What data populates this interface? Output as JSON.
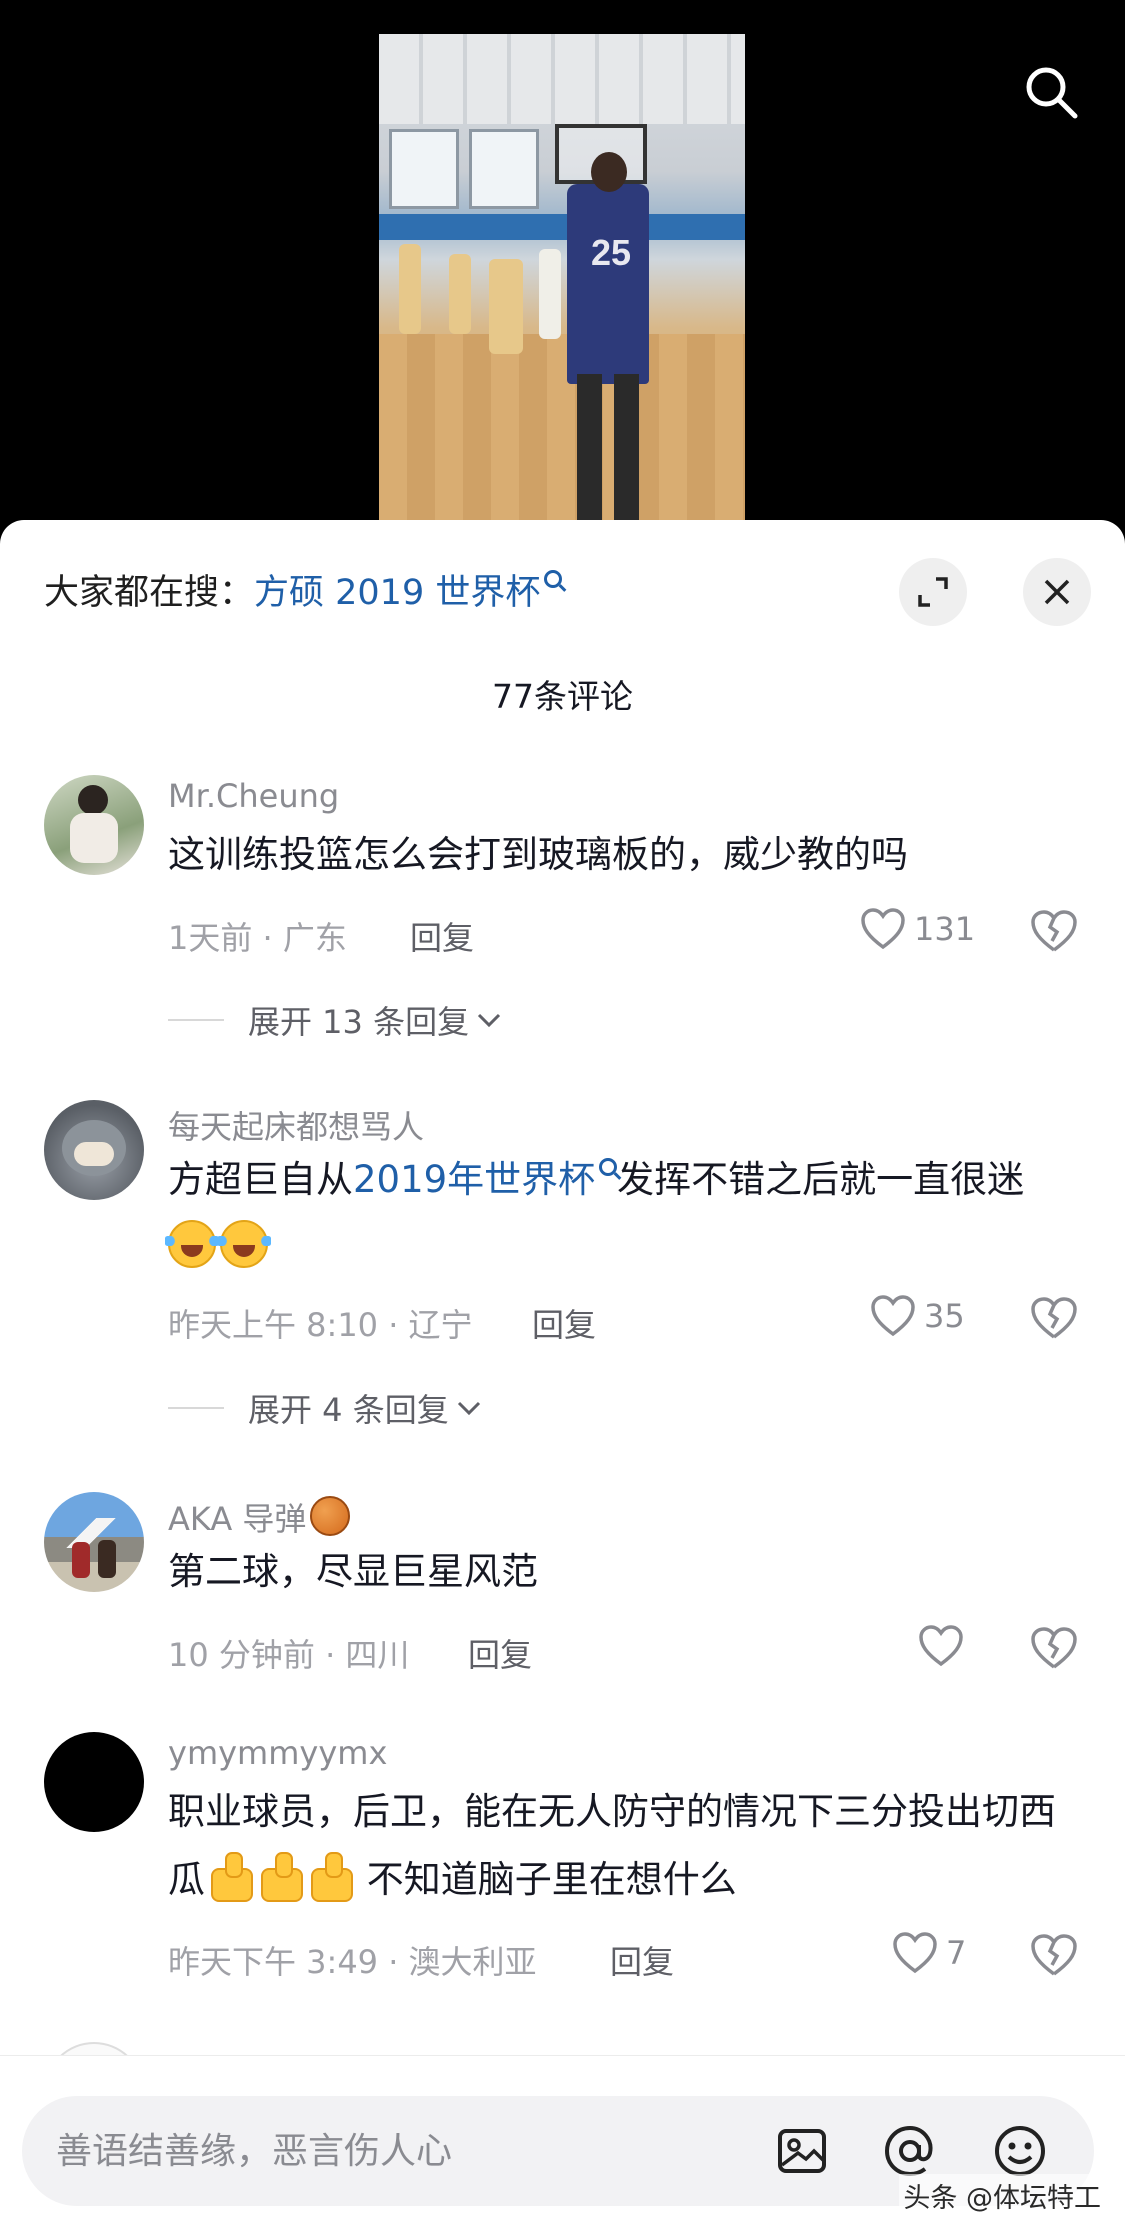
{
  "header": {
    "hot_search_prefix": "大家都在搜：",
    "hot_search_link": "方硕 2019 世界杯"
  },
  "comments_header": {
    "count_label": "77条评论"
  },
  "comments": [
    {
      "user": "Mr.Cheung",
      "text": "这训练投篮怎么会打到玻璃板的，威少教的吗",
      "meta": "1天前 · 广东",
      "reply_label": "回复",
      "likes": "131",
      "expand_label": "展开 13 条回复"
    },
    {
      "user": "每天起床都想骂人",
      "text_before": "方超巨自从",
      "text_link": "2019年世界杯",
      "text_after": "发挥不错之后就一直很迷",
      "meta": "昨天上午 8:10 · 辽宁",
      "reply_label": "回复",
      "likes": "35",
      "expand_label": "展开 4 条回复"
    },
    {
      "user": "AKA 导弹",
      "user_emoji": "basketball-emoji",
      "text": "第二球，尽显巨星风范",
      "meta": "10 分钟前 · 四川",
      "reply_label": "回复",
      "likes": ""
    },
    {
      "user": "ymymmyymx",
      "text_before": "职业球员，后卫，能在无人防守的情况下三分投出切西瓜",
      "text_after": " 不知道脑子里在想什么",
      "meta": "昨天下午 3:49 · 澳大利亚",
      "reply_label": "回复",
      "likes": "7"
    }
  ],
  "input": {
    "placeholder": "善语结善缘，恶言伤人心"
  },
  "watermark": "头条 @体坛特工",
  "icons": {
    "top_right": "search-icon",
    "sheet_buttons": [
      "expand-icon",
      "close-icon"
    ],
    "like": "heart-icon",
    "dislike": "broken-heart-icon",
    "input_bar": [
      "image-icon",
      "at-icon",
      "emoji-icon"
    ]
  },
  "colors": {
    "link": "#1f5fa8",
    "sheet_bg": "#ffffff",
    "muted": "#a0a1a7"
  }
}
